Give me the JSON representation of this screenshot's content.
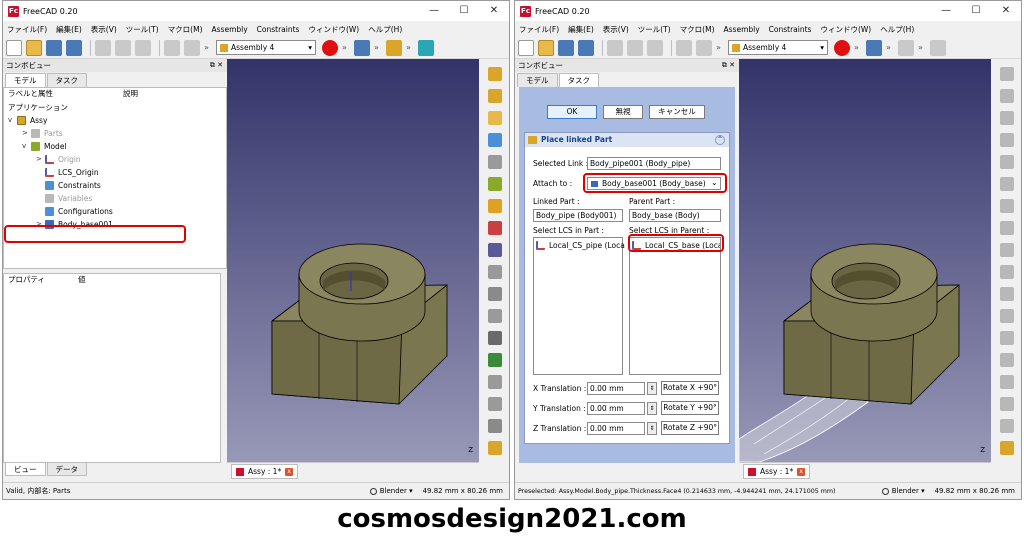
{
  "app": {
    "title": "FreeCAD 0.20",
    "logo_letters": "Fc",
    "window_controls": [
      "—",
      "☐",
      "✕"
    ]
  },
  "menu": [
    "ファイル(F)",
    "編集(E)",
    "表示(V)",
    "ツール(T)",
    "マクロ(M)",
    "Assembly",
    "Constraints",
    "ウィンドウ(W)",
    "ヘルプ(H)"
  ],
  "toolbar": {
    "workbench": "Assembly 4",
    "overflow": "»"
  },
  "left": {
    "panel_title": "コンボビュー",
    "tabs": [
      "モデル",
      "タスク"
    ],
    "tree_header": {
      "label": "ラベルと属性",
      "desc": "説明"
    },
    "tree": {
      "application": "アプリケーション",
      "assy": "Assy",
      "parts": "Parts",
      "model": "Model",
      "origin": "Origin",
      "lcs_origin": "LCS_Origin",
      "constraints": "Constraints",
      "variables": "Variables",
      "configurations": "Configurations",
      "body_base": "Body_base001"
    },
    "props_header": {
      "prop": "プロパティ",
      "value": "値"
    },
    "bottom_tabs": [
      "ビュー",
      "データ"
    ],
    "status": "Valid, 内部名: Parts"
  },
  "right": {
    "panel_title": "コンボビュー",
    "tabs": [
      "モデル",
      "タスク"
    ],
    "buttons": {
      "ok": "OK",
      "cancel1": "無視",
      "cancel2": "キャンセル"
    },
    "task_title": "Place linked Part",
    "selected_link_label": "Selected Link :",
    "selected_link": "Body_pipe001 (Body_pipe)",
    "attach_to_label": "Attach to :",
    "attach_to": "Body_base001 (Body_base)",
    "linked_part_label": "Linked Part :",
    "linked_part": "Body_pipe (Body001)",
    "parent_part_label": "Parent Part :",
    "parent_part": "Body_base (Body)",
    "lcs_part_label": "Select LCS in Part :",
    "lcs_part_item": "Local_CS_pipe (Loca",
    "lcs_parent_label": "Select LCS in Parent :",
    "lcs_parent_item": "Local_CS_base (Loca",
    "x_trans_label": "X Translation :",
    "y_trans_label": "Y Translation :",
    "z_trans_label": "Z Translation :",
    "trans_value": "0.00 mm",
    "rot_x": "Rotate X +90°",
    "rot_y": "Rotate Y +90°",
    "rot_z": "Rotate Z +90°",
    "status": "Preselected: Assy.Model.Body_pipe.Thickness.Face4 (0.214633 mm, -4.944241 mm, 24.171005 mm)"
  },
  "doc_tab": "Assy : 1*",
  "nav_style": "Blender",
  "dims": "49.82 mm x 80.26 mm",
  "axis_label": "Z",
  "watermark": "cosmosdesign2021.com",
  "colors": {
    "highlight": "#e00000",
    "task_bg": "#a7bce0",
    "view_top": "#33336a",
    "view_bottom": "#9898b8",
    "part": "#7a7650"
  }
}
